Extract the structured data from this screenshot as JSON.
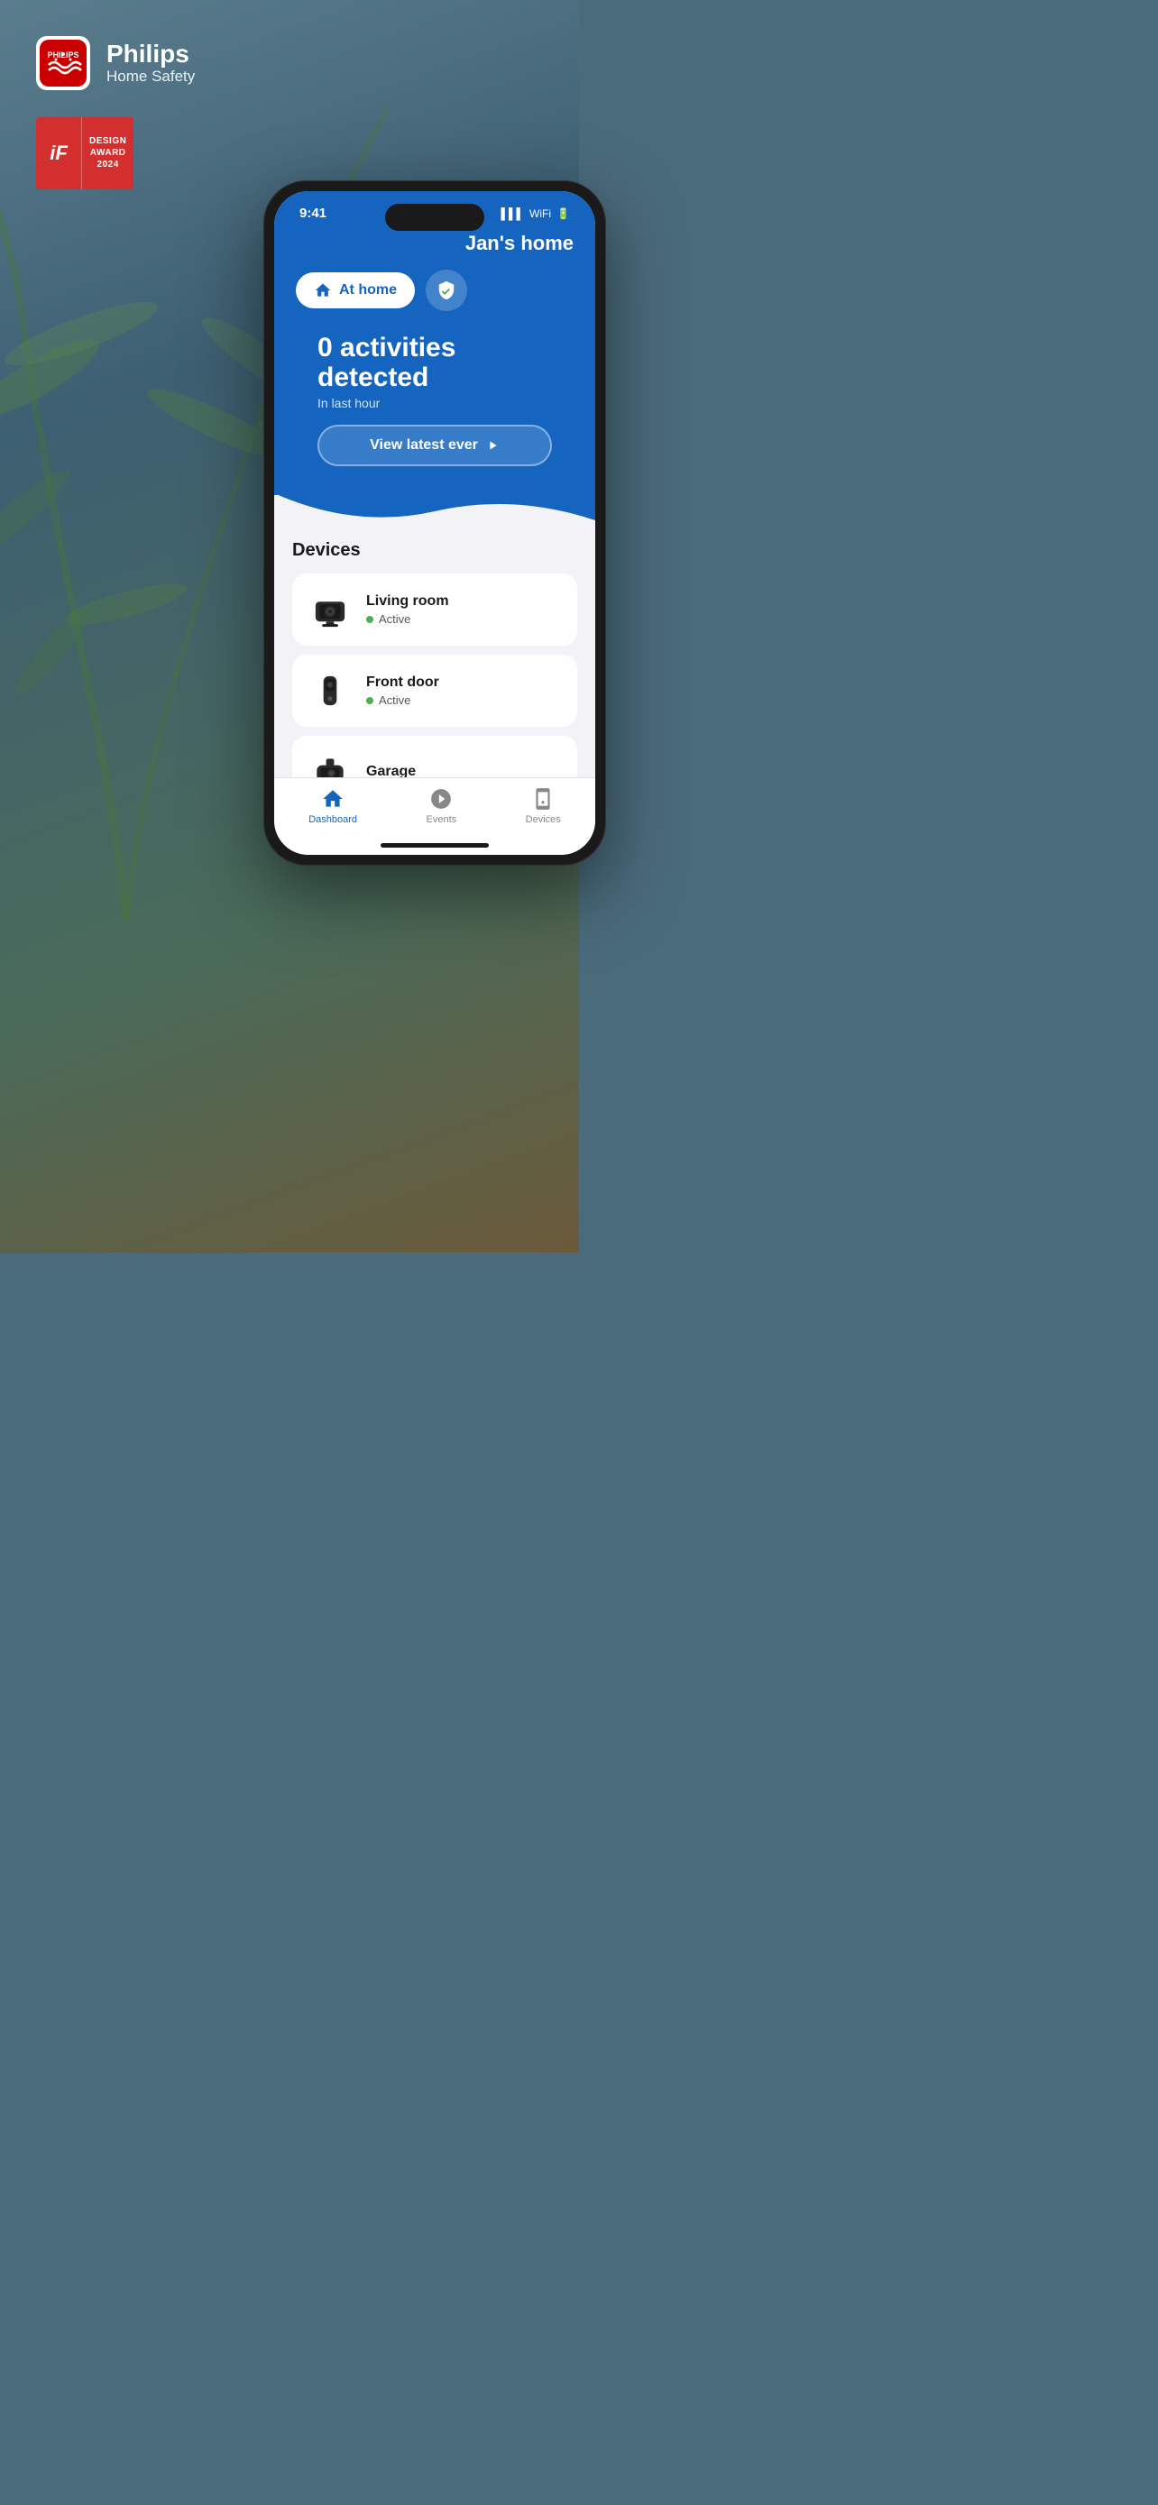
{
  "app": {
    "brand_name": "Philips",
    "brand_subtitle": "Home Safety",
    "if_badge": {
      "left_text": "iF",
      "design": "DESIGN",
      "award": "AWARD",
      "year": "2024"
    }
  },
  "phone": {
    "status_time": "9:41",
    "home_title": "Jan's home",
    "mode_button": "At home",
    "activities_count": "0 activities detected",
    "activities_sub": "In last hour",
    "view_latest_btn": "View latest ever",
    "devices_title": "Devices",
    "devices": [
      {
        "name": "Living room",
        "status": "Active"
      },
      {
        "name": "Front door",
        "status": "Active"
      },
      {
        "name": "Garage",
        "status": ""
      }
    ],
    "nav": [
      {
        "label": "Dashboard",
        "active": true
      },
      {
        "label": "Events",
        "active": false
      },
      {
        "label": "Devices",
        "active": false
      }
    ]
  }
}
